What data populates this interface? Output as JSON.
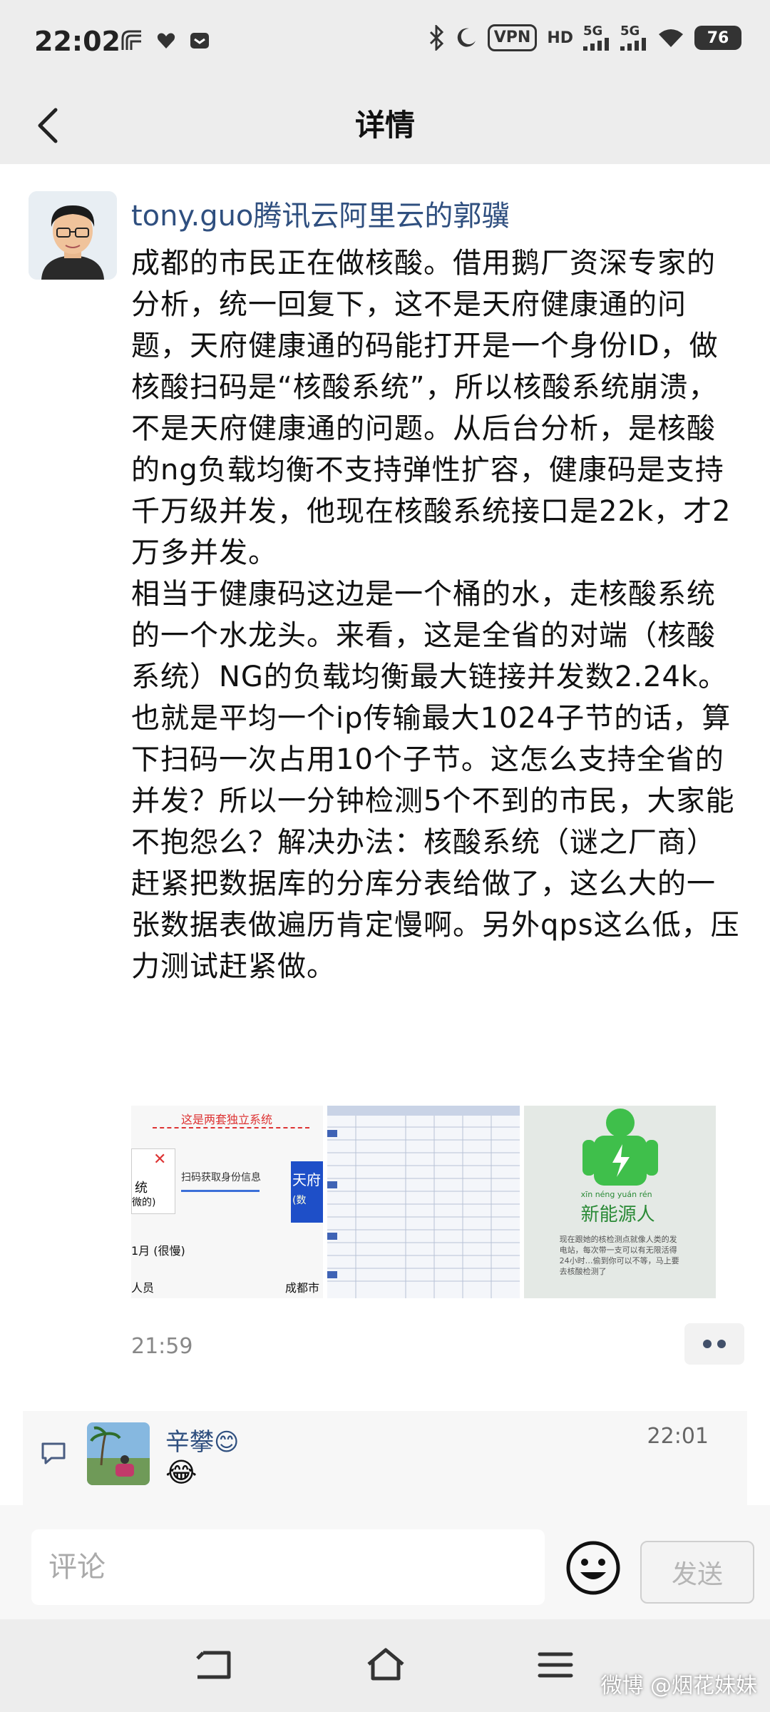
{
  "status_bar": {
    "time": "22:02",
    "vpn": "VPN",
    "hd": "HD",
    "network1": "5G",
    "network2": "5G",
    "battery": "76"
  },
  "header": {
    "title": "详情"
  },
  "post": {
    "author": "tony.guo腾讯云阿里云的郭骥",
    "text": "成都的市民正在做核酸。借用鹅厂资深专家的分析，统一回复下，这不是天府健康通的问题，天府健康通的码能打开是一个身份ID，做核酸扫码是“核酸系统”，所以核酸系统崩溃，不是天府健康通的问题。从后台分析，是核酸的ng负载均衡不支持弹性扩容，健康码是支持千万级并发，他现在核酸系统接口是22k，才2万多并发。\n相当于健康码这边是一个桶的水，走核酸系统的一个水龙头。来看，这是全省的对端（核酸系统）NG的负载均衡最大链接并发数2.24k。也就是平均一个ip传输最大1024子节的话，算下扫码一次占用10个子节。这怎么支持全省的并发？所以一分钟检测5个不到的市民，大家能不抱怨么？解决办法：核酸系统（谜之厂商）赶紧把数据库的分库分表给做了，这么大的一张数据表做遍历肯定慢啊。另外qps这么低，压力测试赶紧做。",
    "time": "21:59",
    "image1": {
      "top_label": "这是两套独立系统",
      "arrow_label": "扫码获取身份信息",
      "left_box": "统",
      "left_box_sub": "微的)",
      "right_box": "天府",
      "right_box_sub": "(数",
      "bottom_left": "1月 (很慢)",
      "bottom_left2": "人员",
      "bottom_right": "成都市"
    },
    "image3": {
      "pinyin": "xīn néng yuán rén",
      "title": "新能源人",
      "desc": "现在跟她的核检测点就像人类的发电站，每次带一支可以有无限活得24小时…偷到你可以不等，马上要去核酸检测了"
    }
  },
  "comment": {
    "name": "辛攀",
    "name_emoji": "😊",
    "time": "22:01",
    "text": "😂"
  },
  "input": {
    "placeholder": "评论",
    "send_label": "发送"
  },
  "watermark": "微博 @烟花妹妹"
}
